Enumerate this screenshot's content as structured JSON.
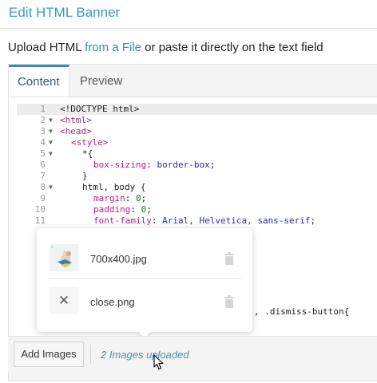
{
  "dialog": {
    "title": "Edit HTML Banner"
  },
  "upload": {
    "prefix": "Upload HTML ",
    "link": "from a File",
    "suffix": " or paste it directly on the text field"
  },
  "tabs": [
    {
      "label": "Content",
      "active": true
    },
    {
      "label": "Preview",
      "active": false
    }
  ],
  "editor": {
    "lines": [
      {
        "n": "1",
        "fold": "",
        "text": "<!DOCTYPE html>"
      },
      {
        "n": "2",
        "fold": "▼",
        "text": "<html>"
      },
      {
        "n": "3",
        "fold": "▼",
        "text": "<head>"
      },
      {
        "n": "4",
        "fold": "▼",
        "text": "<style>"
      },
      {
        "n": "5",
        "fold": "▼",
        "text": "*{"
      },
      {
        "n": "6",
        "fold": "",
        "prop": "box-sizing",
        "sep": ": ",
        "val": "border-box",
        "end": ";"
      },
      {
        "n": "7",
        "fold": "",
        "text": "}"
      },
      {
        "n": "8",
        "fold": "▼",
        "text": "html, body {"
      },
      {
        "n": "9",
        "fold": "",
        "prop": "margin",
        "sep": ": ",
        "val": "0",
        "end": ";"
      },
      {
        "n": "10",
        "fold": "",
        "prop": "padding",
        "sep": ": ",
        "val": "0",
        "end": ";"
      },
      {
        "n": "11",
        "fold": "",
        "prop": "font-family",
        "sep": ": ",
        "val": "Arial, Helvetica, sans-serif",
        "end": ";"
      }
    ],
    "partial_line_tail": ", .dismiss-button{"
  },
  "popover": {
    "files": [
      {
        "name": "700x400.jpg",
        "thumb": "image-thumbnail"
      },
      {
        "name": "close.png",
        "thumb": "close-x-thumbnail"
      }
    ]
  },
  "footer": {
    "add_button": "Add Images",
    "uploaded_text": "2 Images uploaded"
  },
  "colors": {
    "title": "#3a9bb8",
    "link": "#2e8fb0",
    "active_tab_border": "#3a8bb0",
    "tag": "#a0287a",
    "property": "#b51c8a",
    "value": "#2b2bb0",
    "number": "#0a8a0a"
  }
}
